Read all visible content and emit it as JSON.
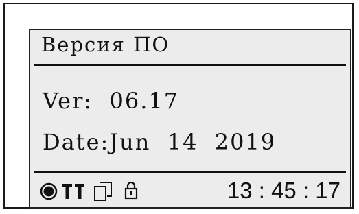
{
  "screen": {
    "title": "Версия ПО",
    "version_label": "Ver:",
    "version_value": "06.17",
    "date_label": "Date:",
    "date_value": "Jun  14  2019"
  },
  "status_bar": {
    "icons": [
      "record-dot-icon",
      "signal-icon",
      "sim-card-icon",
      "lock-icon"
    ],
    "time": "13 : 45 : 17"
  }
}
